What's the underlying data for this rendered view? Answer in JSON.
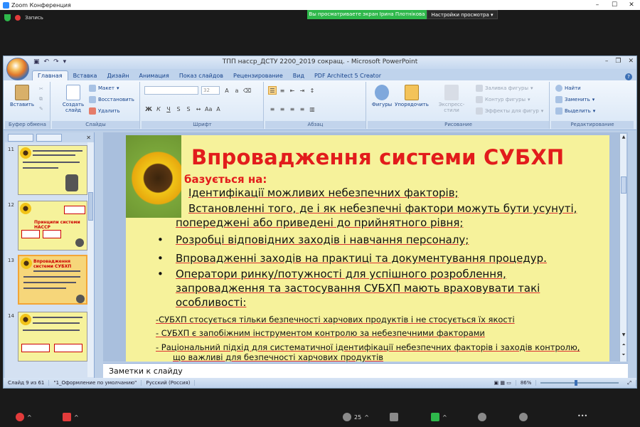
{
  "zoom": {
    "window_title": "Zoom Конференция",
    "recording_label": "Запись",
    "share_banner": "Вы просматриваете экран Ірина Плотнікова",
    "view_options": "Настройки просмотра",
    "participants_count": "25"
  },
  "ppt": {
    "title": "ТПП насср_ДСТУ 2200_2019 сокращ. - Microsoft PowerPoint",
    "tabs": [
      "Главная",
      "Вставка",
      "Дизайн",
      "Анимация",
      "Показ слайдов",
      "Рецензирование",
      "Вид",
      "PDF Architect 5 Creator"
    ],
    "ribbon": {
      "paste": "Вставить",
      "create_slide": "Создать слайд",
      "layout": "Макет",
      "restore": "Восстановить",
      "delete": "Удалить",
      "font_size": "32",
      "shapes": "Фигуры",
      "arrange": "Упорядочить",
      "express_styles": "Экспресс-стили",
      "shape_fill": "Заливка фигуры",
      "shape_outline": "Контур фигуры",
      "shape_effects": "Эффекты для фигур",
      "find": "Найти",
      "replace": "Заменить",
      "select": "Выделить",
      "groups": {
        "clipboard": "Буфер обмена",
        "slides": "Слайды",
        "font": "Шрифт",
        "paragraph": "Абзац",
        "drawing": "Рисование",
        "editing": "Редактирование"
      }
    },
    "thumbnails": [
      {
        "num": "11"
      },
      {
        "num": "12",
        "title": "Принципи системи НАССР"
      },
      {
        "num": "13",
        "title": "Впровадження системи СУБХП"
      },
      {
        "num": "14"
      }
    ],
    "slide": {
      "title": "Впровадження системи СУБХП",
      "subtitle": "базується на:",
      "line1": "Ідентифікації можливих небезпечних факторів;",
      "line2": "Встановленні того, де і як небезпечні фактори можуть бути усунуті,",
      "line3": "попереджені або приведені до прийнятного рівня;",
      "bullet1": "Розробці відповідних заходів і навчання персоналу;",
      "bullet2": "Впровадженні заходів на практиці та документування процедур.",
      "bullet3a": "Оператори ринку/потужності для успішного розроблення,",
      "bullet3b": "запровадження та застосування СУБХП мають враховувати такі",
      "bullet3c": "особливості:",
      "dash1": "-СУБХП стосується тільки безпечності харчових продуктів і не стосується їх якості",
      "dash2": "- СУБХП є запобіжним інструментом контролю за небезпечними факторами",
      "dash3a": "- Раціональний підхід для систематичної ідентифікації небезпечних факторів і заходів контролю,",
      "dash3b": "що важливі для безпечності харчових продуктів"
    },
    "notes_placeholder": "Заметки к слайду",
    "status": {
      "slide_of": "Слайд 9 из 61",
      "theme": "\"1_Оформление по умолчанию\"",
      "language": "Русский (Россия)",
      "zoom": "86%"
    }
  }
}
